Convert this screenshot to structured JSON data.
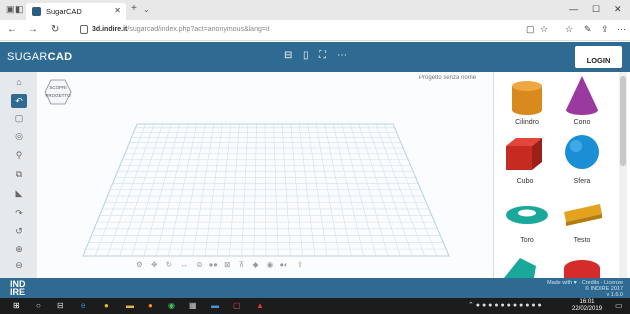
{
  "browser": {
    "tab_title": "SugarCAD",
    "url_domain": "3d.indire.it",
    "url_path": "/sugarcad/index.php?act=anonymous&lang=it"
  },
  "app": {
    "logo_prefix": "SUGAR",
    "logo_suffix": "CAD",
    "login_label": "LOGIN",
    "search_placeholder": "Progetto senza nome",
    "brand_color": "#2e6a92"
  },
  "canvas": {
    "hex_top": "SCOPRI",
    "hex_bottom": "PROGETTO"
  },
  "shapes": [
    {
      "label": "Cilindro",
      "color": "#d98a1f",
      "icon": "cylinder-shape"
    },
    {
      "label": "Cono",
      "color": "#9a3aa0",
      "icon": "cone-shape"
    },
    {
      "label": "Cubo",
      "color": "#c62b22",
      "icon": "cube-shape"
    },
    {
      "label": "Sfera",
      "color": "#1a8fd6",
      "icon": "sphere-shape"
    },
    {
      "label": "Toro",
      "color": "#19a89a",
      "icon": "torus-shape"
    },
    {
      "label": "Testo",
      "color": "#e2a21d",
      "icon": "text-shape"
    }
  ],
  "footer": {
    "brand": "IND\nIRE",
    "made_with": "Made with ♥ · Credits · Licenze\n© INDIRE 2017\nv 1.6.0"
  },
  "taskbar": {
    "time": "16:01",
    "date": "22/02/2019"
  }
}
